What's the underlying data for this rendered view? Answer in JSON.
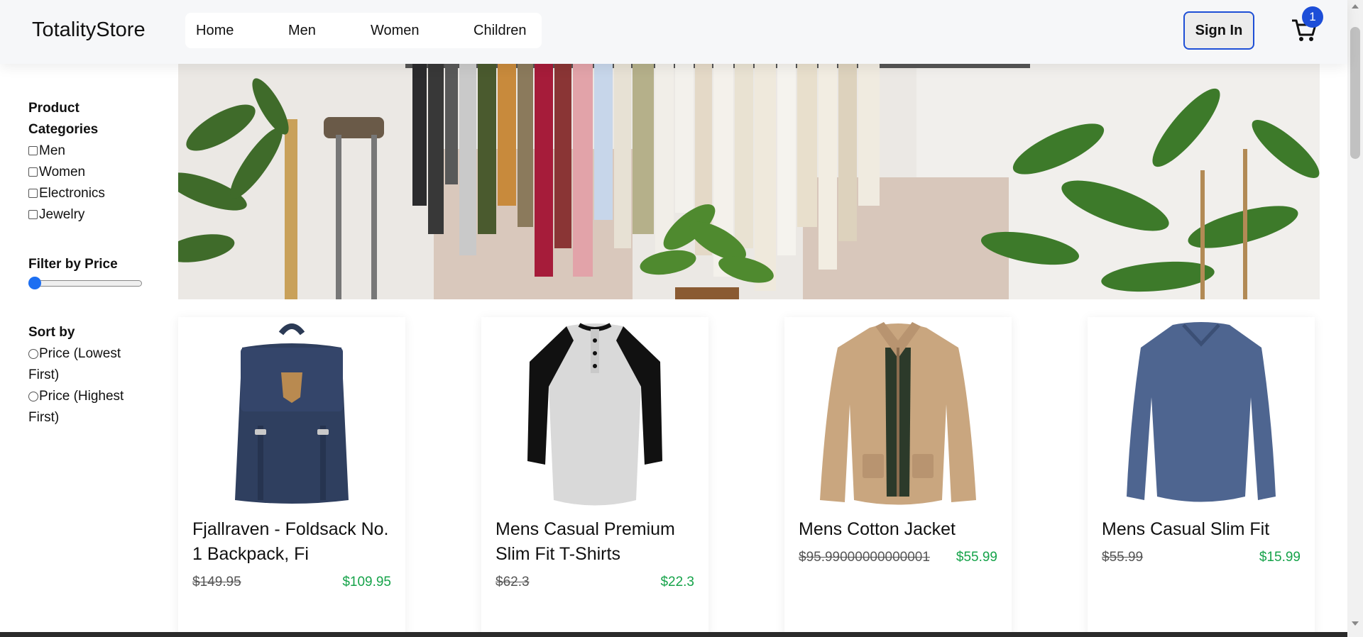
{
  "header": {
    "brand": "TotalityStore",
    "nav": [
      "Home",
      "Men",
      "Women",
      "Children"
    ],
    "sign_in": "Sign In",
    "cart_count": "1",
    "cart_icon": "shopping-cart-icon"
  },
  "sidebar": {
    "categories_heading_line1": "Product",
    "categories_heading_line2": "Categories",
    "categories": [
      "Men",
      "Women",
      "Electronics",
      "Jewelry"
    ],
    "price_heading": "Filter by Price",
    "price_slider_value": 0,
    "sort_heading": "Sort by",
    "sort_options": [
      {
        "line1": "Price (Lowest",
        "line2": "First)"
      },
      {
        "line1": "Price (Highest",
        "line2": "First)"
      }
    ]
  },
  "products": [
    {
      "title_line1": "Fjallraven - Foldsack No.",
      "title_line2": "1 Backpack, Fi",
      "old_price": "$149.95",
      "new_price": "$109.95",
      "image": "backpack"
    },
    {
      "title_line1": "Mens Casual Premium",
      "title_line2": "Slim Fit T-Shirts",
      "old_price": "$62.3",
      "new_price": "$22.3",
      "image": "raglan-tshirt"
    },
    {
      "title_line1": "Mens Cotton Jacket",
      "title_line2": "",
      "old_price": "$95.99000000000001",
      "new_price": "$55.99",
      "image": "cotton-jacket"
    },
    {
      "title_line1": "Mens Casual Slim Fit",
      "title_line2": "",
      "old_price": "$55.99",
      "new_price": "$15.99",
      "image": "longsleeve-tshirt"
    }
  ],
  "colors": {
    "accent_blue": "#1d4ed8",
    "price_green": "#16a34a"
  }
}
